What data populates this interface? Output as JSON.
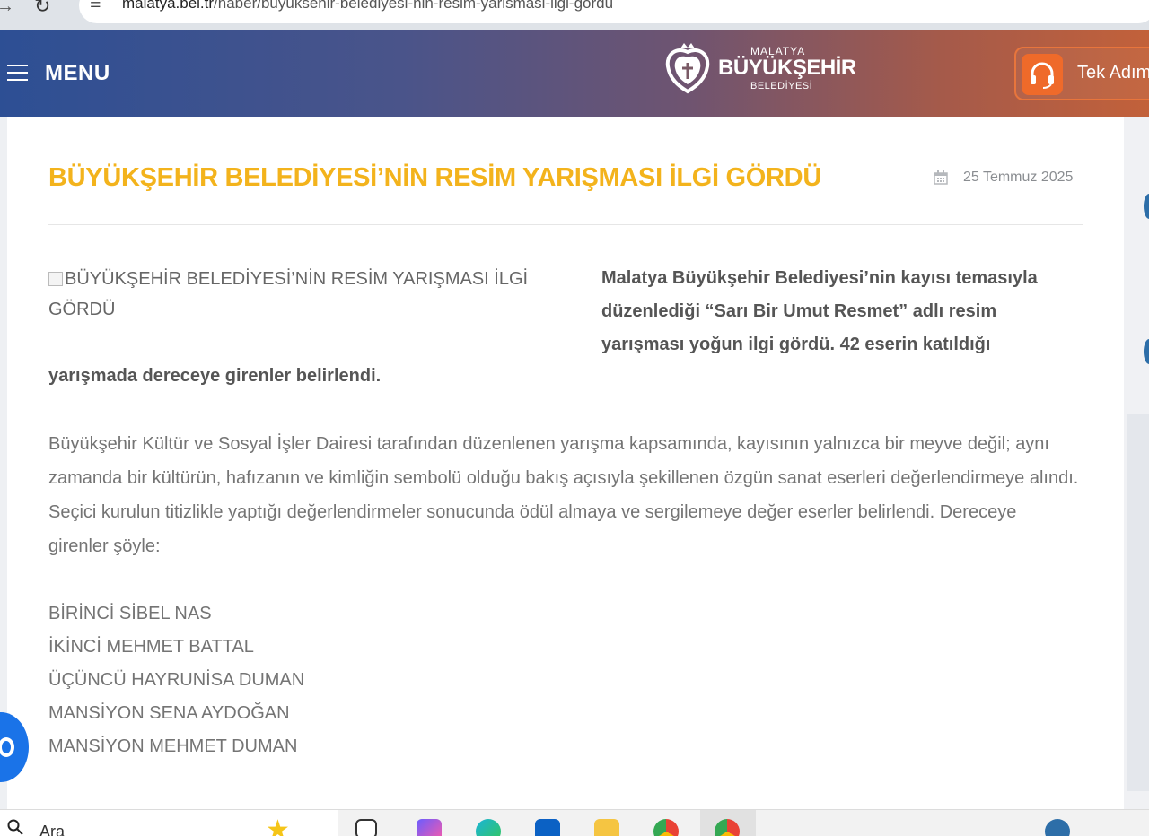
{
  "browser": {
    "url_domain": "malatya.bel.tr",
    "url_path": "/haber/buyuksehir-belediyesi-nin-resim-yarismasi-ilgi-gordu"
  },
  "header": {
    "menu_label": "MENU",
    "logo": {
      "line1": "MALATYA",
      "line2": "BÜYÜKŞEHİR",
      "line3": "BELEDİYESİ"
    },
    "tek_adim_label": "Tek Adım"
  },
  "article": {
    "title": "BÜYÜKŞEHİR BELEDİYESİ’NİN RESİM YARIŞMASI İLGİ GÖRDÜ",
    "date": "25 Temmuz 2025",
    "image_alt": "BÜYÜKŞEHİR BELEDİYESİ’NİN RESİM YARIŞMASI İLGİ GÖRDÜ",
    "lead": "Malatya Büyükşehir Belediyesi’nin kayısı temasıyla düzenlediği “Sarı Bir Umut Resmet” adlı resim yarışması yoğun ilgi gördü. 42 eserin katıldığı",
    "lead_continued": "yarışmada dereceye girenler belirlendi.",
    "paragraph": "Büyükşehir Kültür ve Sosyal İşler Dairesi tarafından düzenlenen yarışma kapsamında, kayısının yalnızca bir meyve değil; aynı zamanda bir kültürün, hafızanın ve kimliğin sembolü olduğu bakış açısıyla şekillenen özgün sanat eserleri değerlendirmeye alındı. Seçici kurulun titizlikle yaptığı değerlendirmeler sonucunda ödül almaya ve sergilemeye değer eserler belirlendi. Dereceye girenler şöyle:",
    "winners": [
      "BİRİNCİ SİBEL NAS",
      "İKİNCİ MEHMET BATTAL",
      "ÜÇÜNCÜ HAYRUNİSA DUMAN",
      "MANSİYON SENA AYDOĞAN",
      "MANSİYON MEHMET DUMAN"
    ]
  },
  "taskbar": {
    "search_placeholder": "Ara"
  },
  "colors": {
    "title": "#f3b31c",
    "header_start": "#2d4f94",
    "header_end": "#c2613a",
    "accent_orange": "#ef6a2a"
  }
}
